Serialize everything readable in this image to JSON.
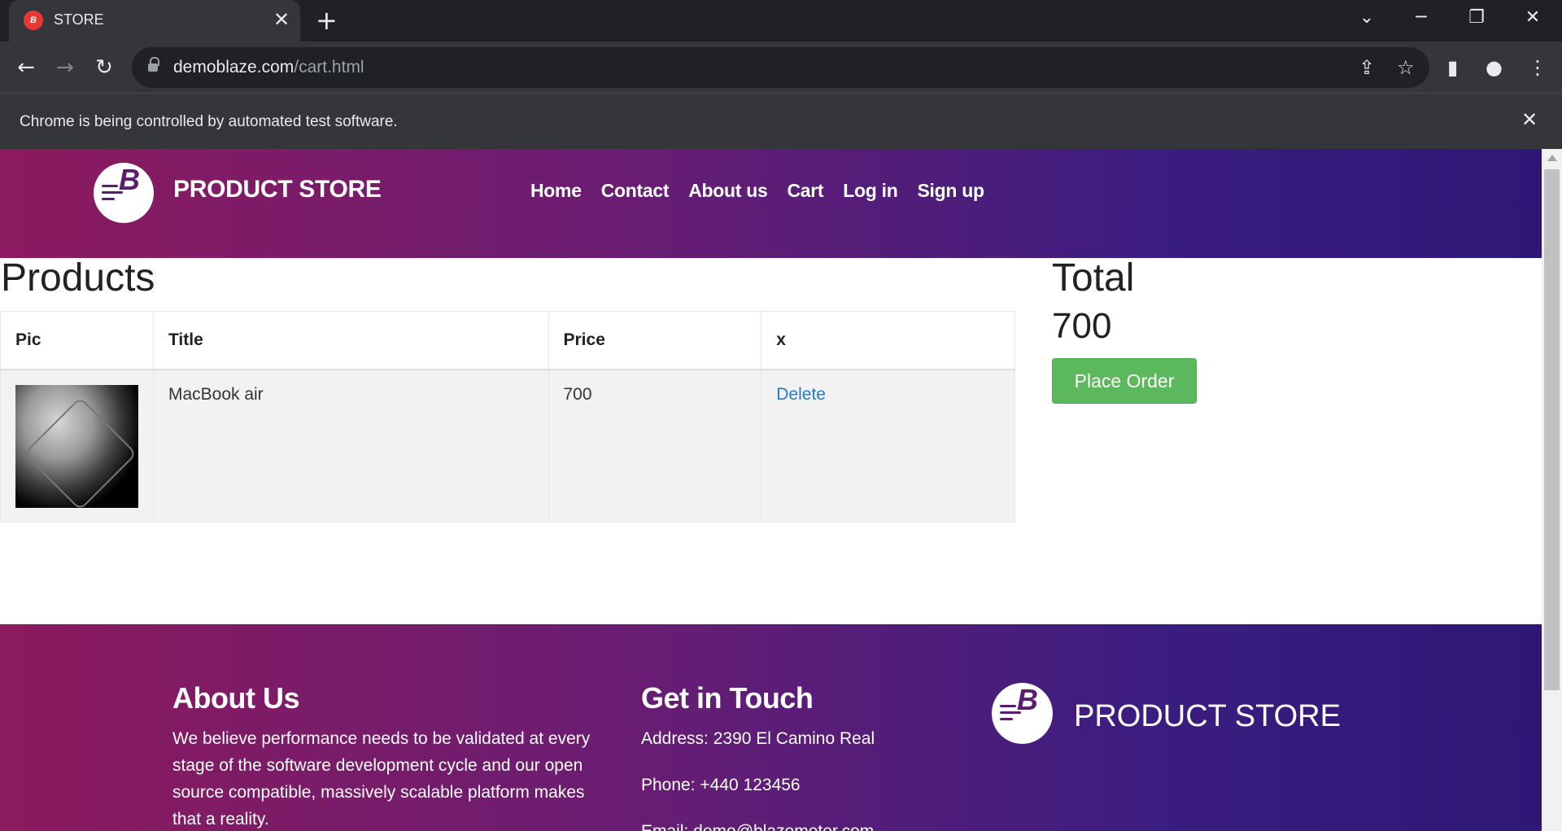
{
  "browser": {
    "tab_title": "STORE",
    "tab_favicon_text": "B",
    "url_host": "demoblaze.com",
    "url_path": "/cart.html",
    "infobar_text": "Chrome is being controlled by automated test software."
  },
  "navbar": {
    "brand": "PRODUCT STORE",
    "logo_letter": "B",
    "links": [
      "Home",
      "Contact",
      "About us",
      "Cart",
      "Log in",
      "Sign up"
    ]
  },
  "cart": {
    "heading": "Products",
    "columns": [
      "Pic",
      "Title",
      "Price",
      "x"
    ],
    "rows": [
      {
        "title": "MacBook air",
        "price": "700",
        "action": "Delete"
      }
    ]
  },
  "total": {
    "heading": "Total",
    "value": "700",
    "button": "Place Order"
  },
  "footer": {
    "about_heading": "About Us",
    "about_text": "We believe performance needs to be validated at every stage of the software development cycle and our open source compatible, massively scalable platform makes that a reality.",
    "touch_heading": "Get in Touch",
    "address": "Address: 2390 El Camino Real",
    "phone": "Phone: +440 123456",
    "email": "Email: demo@blazemeter.com",
    "brand": "PRODUCT STORE",
    "logo_letter": "B"
  },
  "colors": {
    "header_gradient_start": "#8c1a5e",
    "header_gradient_end": "#2e1775",
    "place_order_green": "#5cb85c",
    "link_blue": "#2a7bc6"
  }
}
